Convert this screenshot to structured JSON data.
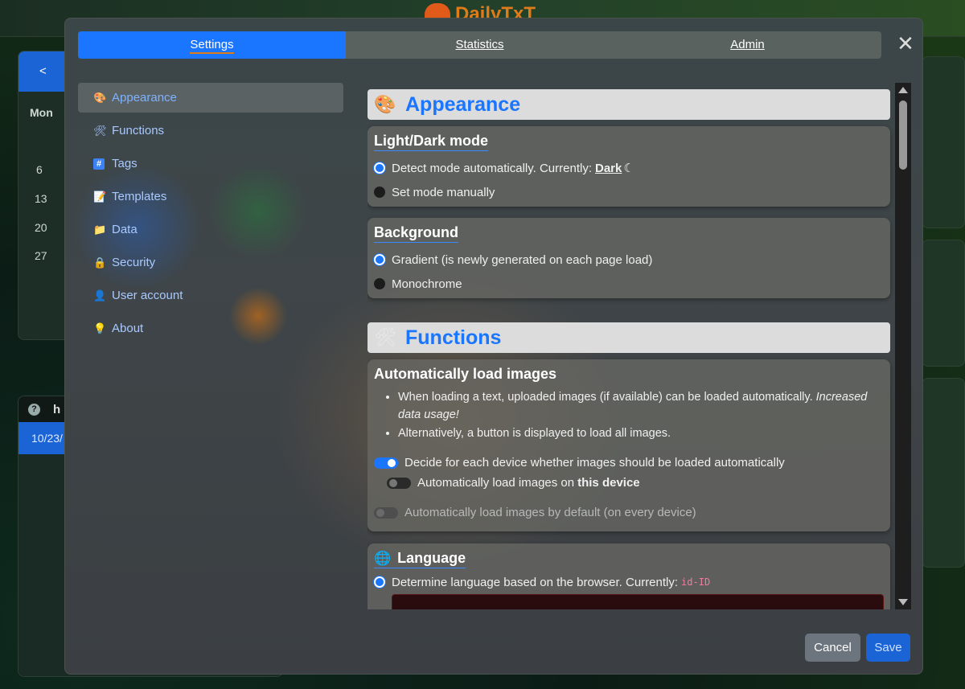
{
  "background_app": {
    "logo_text": "DailyTxT",
    "calendar": {
      "nav_prev": "<",
      "weekday": "Mon",
      "days": [
        "6",
        "13",
        "20",
        "27"
      ]
    },
    "log": {
      "help": "?",
      "tab_initial": "h",
      "date_partial": "10/23/"
    }
  },
  "modal": {
    "tabs": [
      {
        "label": "Settings",
        "active": true
      },
      {
        "label": "Statistics",
        "active": false
      },
      {
        "label": "Admin",
        "active": false
      }
    ],
    "close_symbol": "✕",
    "sidebar": [
      {
        "label": "Appearance",
        "icon": "palette-icon",
        "glyph": "🎨",
        "active": true
      },
      {
        "label": "Functions",
        "icon": "tools-icon",
        "glyph": "🛠",
        "active": false
      },
      {
        "label": "Tags",
        "icon": "hash-icon",
        "glyph": "#",
        "active": false
      },
      {
        "label": "Templates",
        "icon": "document-icon",
        "glyph": "📝",
        "active": false
      },
      {
        "label": "Data",
        "icon": "folder-icon",
        "glyph": "📁",
        "active": false
      },
      {
        "label": "Security",
        "icon": "lock-icon",
        "glyph": "🔒",
        "active": false
      },
      {
        "label": "User account",
        "icon": "user-icon",
        "glyph": "👤",
        "active": false
      },
      {
        "label": "About",
        "icon": "lightbulb-icon",
        "glyph": "💡",
        "active": false
      }
    ],
    "sections": {
      "appearance": {
        "title": "Appearance",
        "icon": "palette-icon",
        "glyph": "🎨",
        "light_dark": {
          "title": "Light/Dark mode",
          "option_auto": "Detect mode automatically. Currently:",
          "current_mode": "Dark",
          "moon_glyph": "☾",
          "option_manual": "Set mode manually",
          "selected": "auto"
        },
        "background": {
          "title": "Background",
          "option_gradient": "Gradient (is newly generated on each page load)",
          "option_mono": "Monochrome",
          "selected": "gradient"
        }
      },
      "functions": {
        "title": "Functions",
        "icon": "tools-icon",
        "glyph": "🛠",
        "auto_images": {
          "title": "Automatically load images",
          "bullet1": "When loading a text, uploaded images (if available) can be loaded automatically.",
          "bullet1_em": "Increased data usage!",
          "bullet2": "Alternatively, a button is displayed to load all images.",
          "toggle_per_device": "Decide for each device whether images should be loaded automatically",
          "toggle_this_device_prefix": "Automatically load images on",
          "toggle_this_device_bold": "this device",
          "toggle_default": "Automatically load images by default (on every device)",
          "per_device_on": true,
          "this_device_on": false,
          "default_on": false
        }
      },
      "language": {
        "title": "Language",
        "icon": "globe-icon",
        "glyph": "🌐",
        "option_browser": "Determine language based on the browser. Currently:",
        "current_code": "id-ID"
      }
    },
    "buttons": {
      "cancel": "Cancel",
      "save": "Save"
    }
  }
}
